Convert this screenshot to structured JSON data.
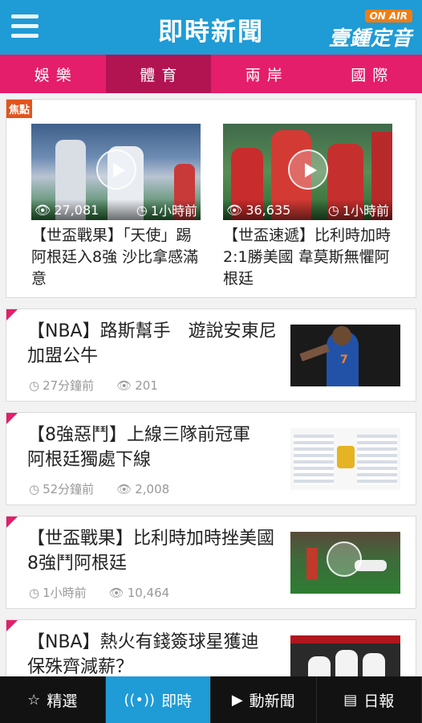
{
  "header": {
    "title": "即時新聞",
    "brand_tag": "ON AIR",
    "brand_name": "壹鍾定音"
  },
  "categories": [
    "娛樂",
    "體育",
    "兩岸",
    "國際"
  ],
  "active_category": "體育",
  "featured": {
    "tag": "焦點",
    "cards": [
      {
        "views": "27,081",
        "time": "1小時前",
        "title": "【世盃戰果】「天使」踢阿根廷入8強 沙比拿感滿意"
      },
      {
        "views": "36,635",
        "time": "1小時前",
        "title": "【世盃速遞】比利時加時2:1勝美國 韋莫斯無懼阿根廷"
      }
    ]
  },
  "news": [
    {
      "title": "【NBA】路斯幫手　遊說安東尼加盟公牛",
      "time": "27分鐘前",
      "views": "201"
    },
    {
      "title": "【8強惡鬥】上線三隊前冠軍　阿根廷獨處下線",
      "time": "52分鐘前",
      "views": "2,008"
    },
    {
      "title": "【世盃戰果】比利時加時挫美國 8強鬥阿根廷",
      "time": "1小時前",
      "views": "10,464"
    },
    {
      "title": "【NBA】熱火有錢簽球星獲迪 保殊齊減薪？",
      "time": "",
      "views": ""
    }
  ],
  "bottom_tabs": [
    {
      "icon": "star-icon",
      "label": "精選"
    },
    {
      "icon": "broadcast-icon",
      "label": "即時"
    },
    {
      "icon": "play-circle-icon",
      "label": "動新聞"
    },
    {
      "icon": "newspaper-icon",
      "label": "日報"
    }
  ],
  "active_bottom_tab": "即時",
  "colors": {
    "header_blue": "#1f9bd6",
    "category_pink": "#e41e6a",
    "category_active": "#b21452",
    "focus_orange": "#e2541c",
    "bottom_bar": "#121212"
  }
}
